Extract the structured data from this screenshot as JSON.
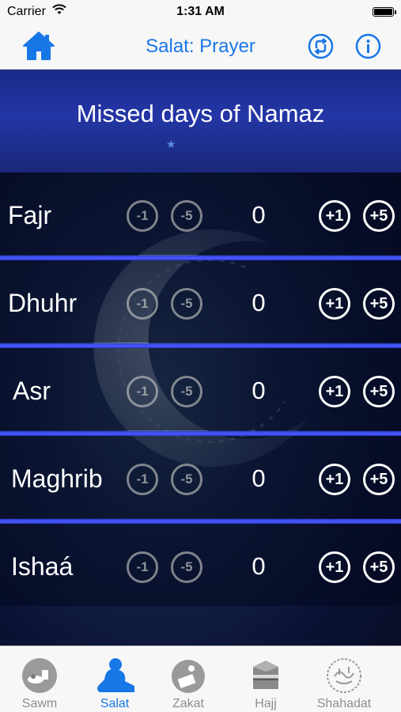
{
  "status_bar": {
    "carrier": "Carrier",
    "time": "1:31 AM"
  },
  "navbar": {
    "title": "Salat: Prayer",
    "left_icon": "home-icon",
    "right_icons": [
      "sync-icon",
      "info-icon"
    ]
  },
  "banner": {
    "heading": "Missed days of Namaz"
  },
  "buttons": {
    "minus_one": "-1",
    "minus_five": "-5",
    "plus_one": "+1",
    "plus_five": "+5"
  },
  "prayers": [
    {
      "name": "Fajr",
      "count": "0"
    },
    {
      "name": "Dhuhr",
      "count": "0"
    },
    {
      "name": "Asr",
      "count": "0"
    },
    {
      "name": "Maghrib",
      "count": "0"
    },
    {
      "name": "Ishaá",
      "count": "0"
    }
  ],
  "tabs": [
    {
      "label": "Sawm",
      "icon": "sawm-icon"
    },
    {
      "label": "Salat",
      "icon": "salat-icon",
      "active": true
    },
    {
      "label": "Zakat",
      "icon": "zakat-icon"
    },
    {
      "label": "Hajj",
      "icon": "hajj-icon"
    },
    {
      "label": "Shahadat",
      "icon": "shahadat-icon"
    }
  ],
  "colors": {
    "accent": "#1877e6",
    "row_separator": "#3d4ef0",
    "banner": "#2436a6"
  }
}
